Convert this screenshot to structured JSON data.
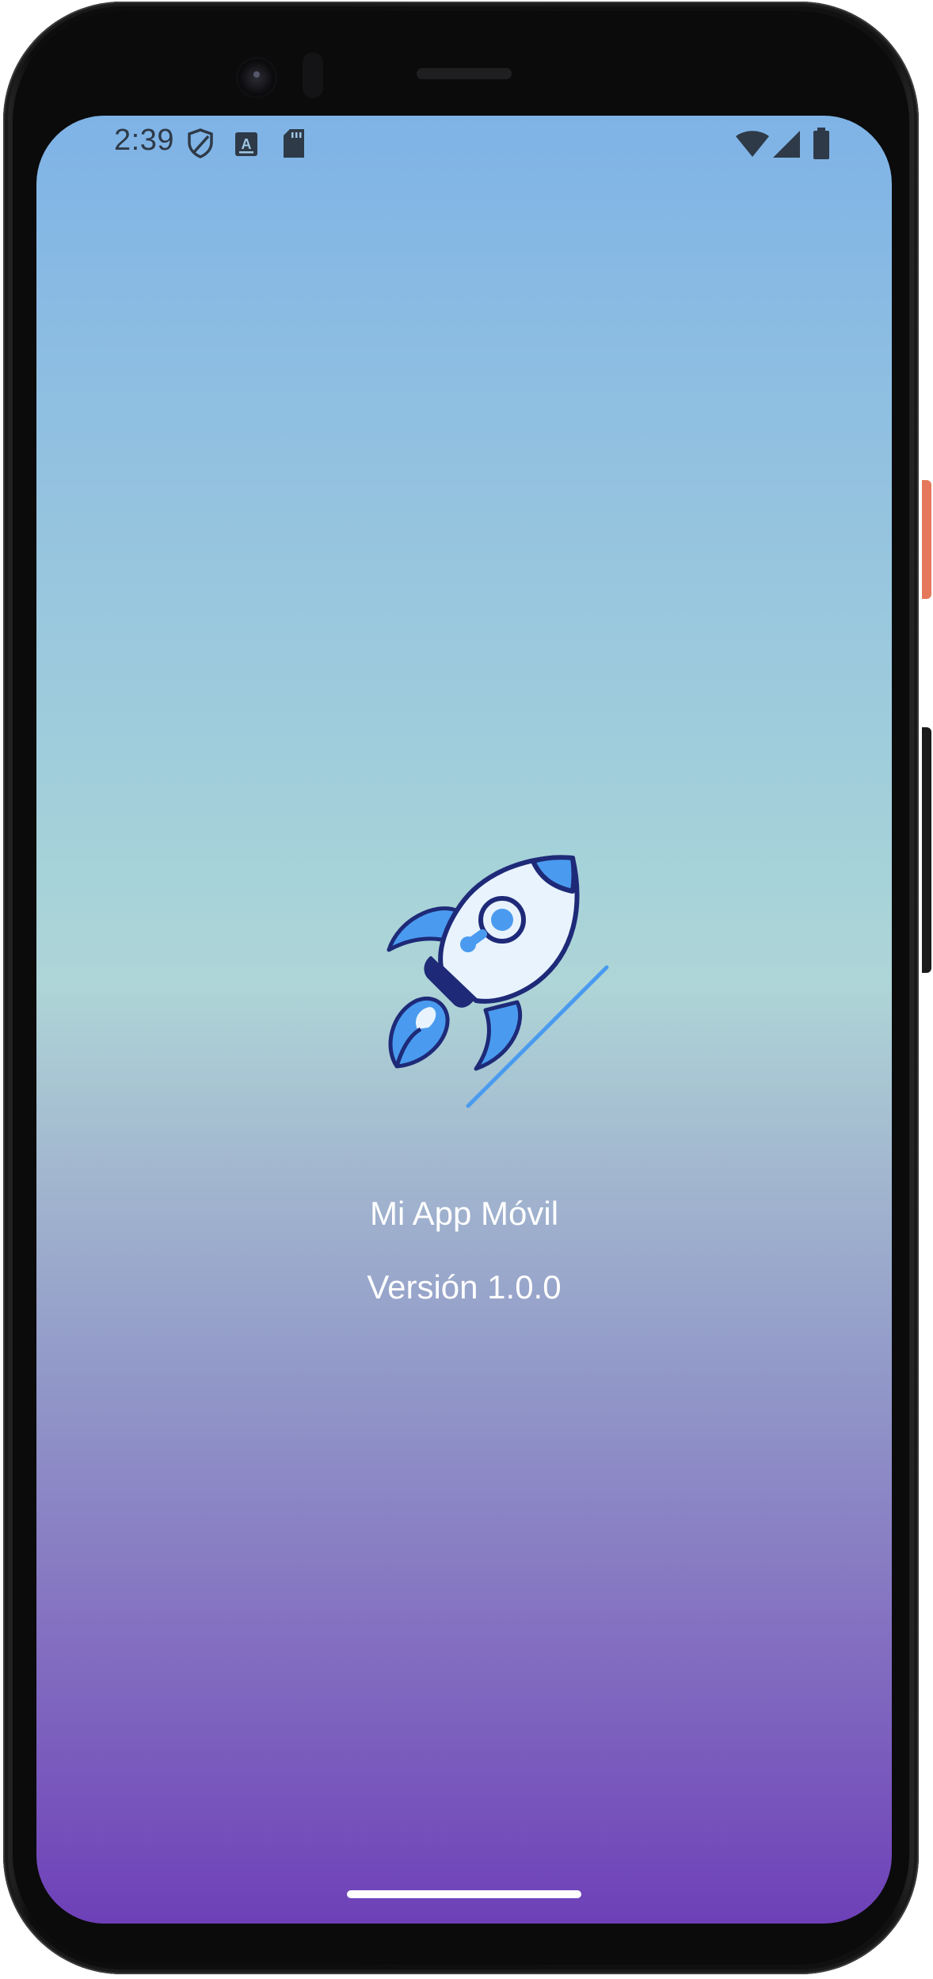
{
  "status_bar": {
    "time": "2:39",
    "left_icons": [
      "shield-icon",
      "text-a-icon",
      "sd-card-icon"
    ],
    "right_icons": [
      "wifi-icon",
      "cell-signal-icon",
      "battery-icon"
    ],
    "text_color": "#2e3a48"
  },
  "splash": {
    "logo": "rocket-icon",
    "title": "Mi App Móvil",
    "version": "Versión 1.0.0",
    "text_color": "#ffffff"
  },
  "colors": {
    "gradient_top": "#7fb3e6",
    "gradient_mid": "#aed5d7",
    "gradient_bottom": "#6e40b8",
    "rocket_outline": "#1e2a78",
    "rocket_fill": "#e8f3fd",
    "rocket_accent": "#4a9bef"
  }
}
